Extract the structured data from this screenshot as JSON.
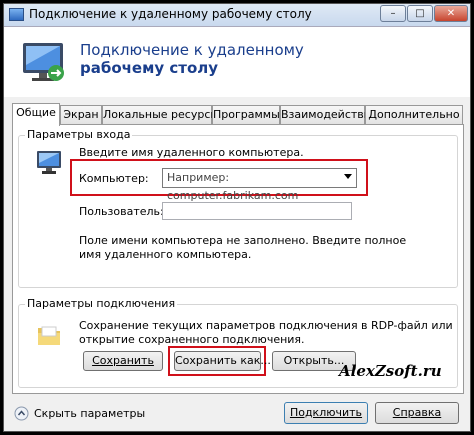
{
  "window": {
    "title": "Подключение к удаленному рабочему столу",
    "minimize": "–",
    "maximize": "□",
    "close": "✕"
  },
  "header": {
    "line1": "Подключение к удаленному",
    "line2": "рабочему столу"
  },
  "tabs": [
    "Общие",
    "Экран",
    "Локальные ресурсы",
    "Программы",
    "Взаимодействие",
    "Дополнительно"
  ],
  "login": {
    "group_title": "Параметры входа",
    "instruction": "Введите имя удаленного компьютера.",
    "computer_label": "Компьютер:",
    "computer_placeholder": "Например: computer.fabrikam.com",
    "user_label": "Пользователь:",
    "user_value": "",
    "note_line1": "Поле имени компьютера не заполнено. Введите полное",
    "note_line2": "имя удаленного компьютера."
  },
  "connection": {
    "group_title": "Параметры подключения",
    "desc_line1": "Сохранение текущих параметров подключения в RDP-файл или",
    "desc_line2": "открытие сохраненного подключения.",
    "save": "Сохранить",
    "save_as": "Сохранить как...",
    "open": "Открыть..."
  },
  "footer": {
    "hide_options": "Скрыть параметры",
    "connect": "Подключить",
    "help": "Справка"
  },
  "watermark": "AlexZsoft.ru",
  "colors": {
    "highlight": "#d0101a",
    "header_text": "#1a3e8c"
  }
}
